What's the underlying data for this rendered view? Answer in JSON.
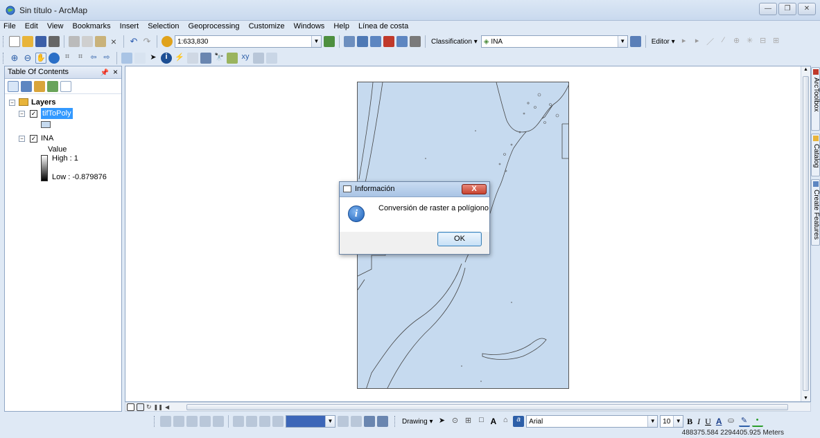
{
  "window": {
    "title": "Sin título - ArcMap",
    "controls": [
      "—",
      "❐",
      "✕"
    ]
  },
  "menu": [
    "File",
    "Edit",
    "View",
    "Bookmarks",
    "Insert",
    "Selection",
    "Geoprocessing",
    "Customize",
    "Windows",
    "Help",
    "Línea de costa"
  ],
  "toolbar": {
    "scale_value": "1:633,830",
    "classification_label": "Classification ▾",
    "layer_combo_value": "INA",
    "editor_label": "Editor ▾"
  },
  "toc": {
    "title": "Table Of Contents",
    "group_label": "Layers",
    "layers": [
      {
        "name": "tifToPoly",
        "checked": true,
        "selected": true
      },
      {
        "name": "INA",
        "checked": true,
        "selected": false
      }
    ],
    "legend": {
      "field": "Value",
      "high": "High : 1",
      "low": "Low : -0.879876"
    }
  },
  "right_dock": [
    "ArcToolbox",
    "Catalog",
    "Create Features"
  ],
  "dialog": {
    "title": "Información",
    "close_label": "X",
    "message": "Conversión de raster a polígiono",
    "ok_label": "OK",
    "icon_glyph": "i"
  },
  "drawing_toolbar": {
    "drawing_label": "Drawing ▾",
    "font_name": "Arial",
    "font_size": "10",
    "bold": "B",
    "italic": "I",
    "underline": "U",
    "font_color_glyph": "A"
  },
  "status": {
    "coordinates": "488375.584  2294405.925 Meters"
  },
  "colors": {
    "map_fill": "#c6daef",
    "chrome": "#dfe9f5",
    "selection": "#3399ff"
  }
}
